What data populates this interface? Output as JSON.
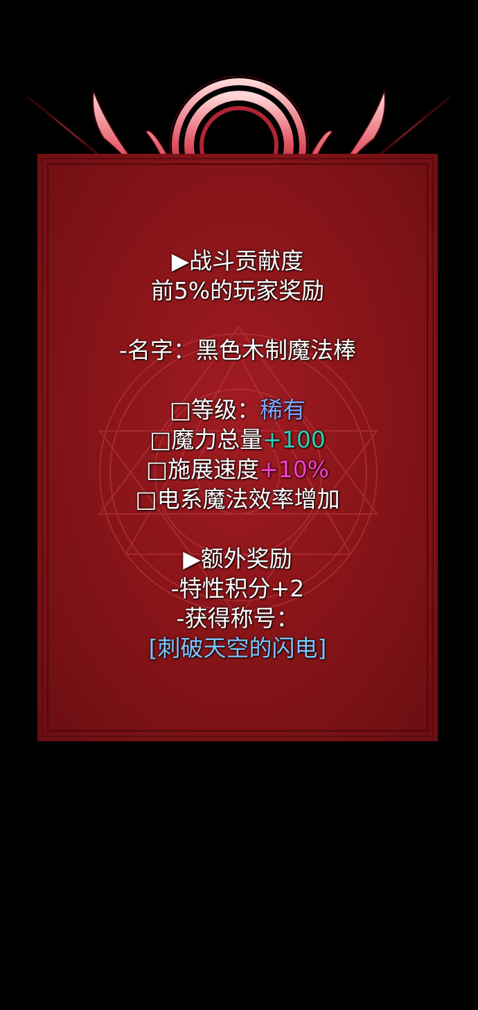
{
  "section_main": {
    "header": "▶战斗贡献度",
    "subheader": "前5%的玩家奖励"
  },
  "item": {
    "name_line": "-名字：黑色木制魔法棒",
    "stats": [
      {
        "prefix": "□等级：",
        "value": "稀有"
      },
      {
        "prefix": "□魔力总量",
        "value": "+100"
      },
      {
        "prefix": "□施展速度",
        "value": "+10%"
      },
      {
        "prefix": "□电系魔法效率增加",
        "value": ""
      }
    ]
  },
  "section_extra": {
    "header": "▶额外奖励",
    "trait_points": "-特性积分+2",
    "title_label": "-获得称号：",
    "title_value": "[刺破天空的闪电]"
  },
  "colors": {
    "panel": "#8a1519",
    "rarity": "#7fa6ff",
    "mana": "#2fd1b4",
    "speed": "#ff3fd0",
    "title": "#7ec6ff"
  }
}
